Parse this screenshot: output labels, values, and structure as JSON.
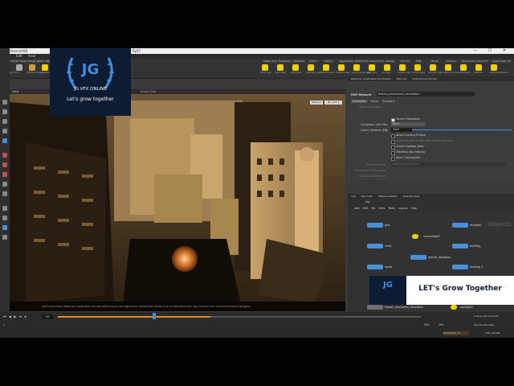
{
  "window": {
    "title_path": "C:/Users/USR",
    "file_title": "fly57",
    "controls": "— ☐ ✕"
  },
  "menubar": [
    "File",
    "Edit",
    "Asse"
  ],
  "shelf": {
    "tabs_left": [
      "Create",
      "Modify",
      "Model",
      "Polygon",
      "Deform",
      "Texture",
      "Rigging",
      "Charac",
      "Constr",
      "Hair Ut",
      "Guide Process",
      "Terrain FX",
      "Simple FX",
      "Cloud FX",
      "Volume"
    ],
    "tabs_right": [
      "Lights and Cameras",
      "Collisions",
      "Particles",
      "Grains",
      "Vellum",
      "Rigid Bodies",
      "Particle Fluids",
      "Viscous Fluids",
      "Oceans",
      "Pyro FX",
      "FEM",
      "Wires",
      "Crowds",
      "Drive Simulation",
      "Cloud FX",
      "Legacy Pyro FX"
    ],
    "tools": [
      "Spray Paint",
      "Font",
      "Platonic Solids",
      "L-System",
      "Metaball",
      "File",
      "Script",
      "Null",
      "Camera",
      "Point Light",
      "Spot Light",
      "Area Light",
      "Geometry Light",
      "Volume Light",
      "Distant Light",
      "Environment Light",
      "Sky Light",
      "GI Light",
      "Caustic Light",
      "Portal Light",
      "Ambient Light",
      "Stereo Camera",
      "VR Camera",
      "Switcher",
      "Gamepad Camera"
    ]
  },
  "viewport": {
    "tab": "View",
    "header_tabs": [
      "Scene View",
      "Animation Editor",
      "Render View",
      "Composite View",
      "Motion FX View",
      "Geometry Spreadsheet"
    ],
    "camera_label": "Persp ▾",
    "cam_label": "No cam ▾",
    "status": "Left mouse tumbles. Middle pans. Right dollies. Ctrl+Alt+Left box-zooms. Ctrl+Right zooms. Spacebar-Ctrl-Left tilts. Hold L for alternate tumble, dolly, and zoom.   M or Alt+M for First Person Navigation."
  },
  "params_panel": {
    "tabs": [
      "Network: /obj/fireball_shockwave",
      "Take List",
      "Performance Monitor"
    ],
    "node_type": "DOP Network",
    "node_name": "fireball_shockwave_simulation",
    "subtabs": [
      "Simulation",
      "Cache",
      "Transform"
    ],
    "reset_label": "Reset Simulation",
    "cache_sim_label": "Cache Simulation",
    "compress_label": "Compress .sim Files",
    "compress_value": "None",
    "cache_mem_label": "Cache Memory (MB)",
    "cache_mem_value": "5000",
    "options": [
      "Allow Caching To Disk",
      "Cache to Disk in Non-Interactive Sessions",
      "Cache Substep Data",
      "Timeless (No History)",
      "Save Checkpoints"
    ],
    "checkpoint_file_label": "Checkpoint File",
    "checkpoint_file_value": "$HIP/sim/$OS_$SF.sim",
    "checkpoint_trail_label": "Checkpoint Trail Length",
    "checkpoint_interval_label": "Checkpoint Interval"
  },
  "network": {
    "tabs": [
      "/obj",
      "Tree View",
      "Material Palette",
      "Asset Browser"
    ],
    "path": "obj",
    "menu": [
      "Add",
      "Edit",
      "Go",
      "View",
      "Tools",
      "Layout",
      "Help"
    ],
    "context_label": "Objects",
    "nodes": [
      {
        "label": "grid",
        "color": "#4a90d9"
      },
      {
        "label": "envlight1",
        "color": "#f0d000"
      },
      {
        "label": "volumelight1",
        "color": "#f0d000"
      },
      {
        "label": "building_",
        "color": "#4a90d9"
      },
      {
        "label": "cam1",
        "color": "#4a90d9"
      },
      {
        "label": "ground_explosion",
        "color": "#4a90d9"
      },
      {
        "label": "building_3",
        "color": "#4a90d9"
      },
      {
        "label": "bomb",
        "color": "#4a90d9"
      },
      {
        "label": "fireball_shockwave_simulation",
        "color": "#6f6f6f"
      },
      {
        "label": "spotlight1",
        "color": "#f0d000"
      }
    ]
  },
  "timeline": {
    "frame": "20",
    "start": "1",
    "end": "200",
    "end2": "200",
    "keys_label": "0 keys, 0/0 channels",
    "key_all_label": "Key All Channels",
    "auto_update": "Auto Update",
    "file_label": "slowfireball_dt..."
  },
  "watermark": {
    "monogram": "JG",
    "name": "JG VFX ONLINE",
    "slogan": "Let's grow together",
    "banner_text": "LET's Grow Together"
  },
  "colors": {
    "brand_navy": "#0e1c33",
    "accent_blue": "#3f8fdc",
    "fire_orange": "#d9772b",
    "timeline_orange": "#e08a2a"
  }
}
